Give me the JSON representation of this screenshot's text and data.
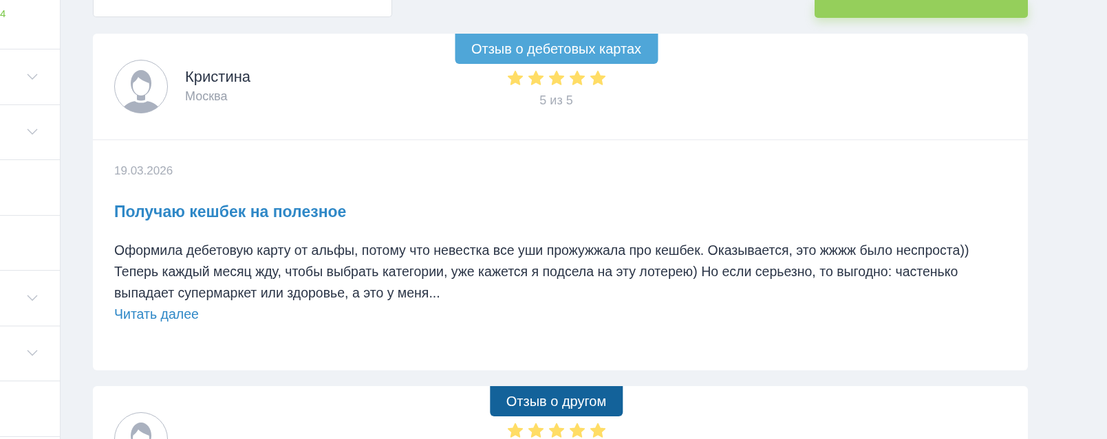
{
  "sidebar": {
    "top_value": "4",
    "items": [
      {
        "expandable": true
      },
      {
        "expandable": true
      },
      {
        "expandable": false
      },
      {
        "expandable": false
      },
      {
        "expandable": true
      },
      {
        "expandable": true
      },
      {
        "expandable": false
      }
    ]
  },
  "reviews": [
    {
      "category": "Отзыв о дебетовых картах",
      "color": "#4fa6d8",
      "name": "Кристина",
      "city": "Москва",
      "stars": 5,
      "rating": "5 из 5",
      "date": "19.03.2026",
      "title": "Получаю кешбек на полезное",
      "text": "Оформила дебетовую карту от альфы, потому что невестка все уши прожужжала про кешбек. Оказывается, это жжжж было неспроста)) Теперь каждый месяц жду, чтобы выбрать категории, уже кажется я подсела на эту лотерею) Но если серьезно, то выгодно: частенько выпадает супермаркет или здоровье, а это у меня...",
      "read_more": "Читать далее"
    },
    {
      "category": "Отзыв о другом",
      "color": "#13629a",
      "stars": 5
    }
  ]
}
